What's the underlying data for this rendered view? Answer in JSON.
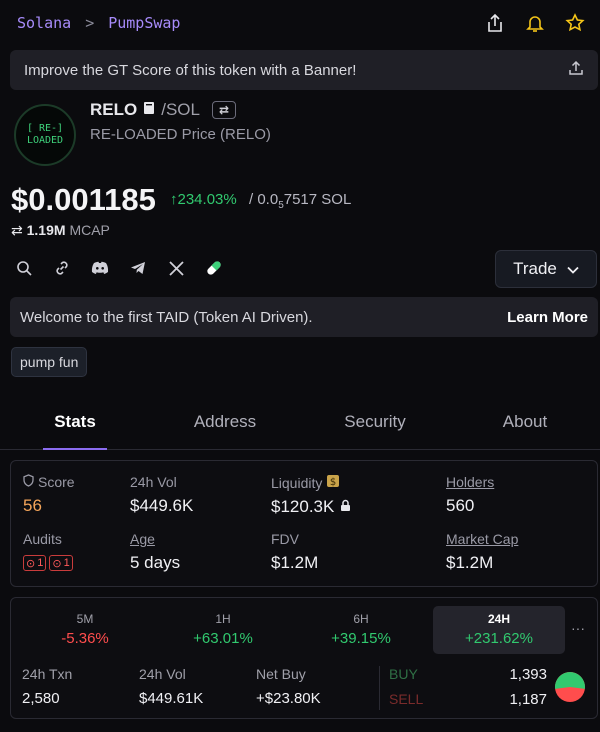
{
  "breadcrumb": {
    "chain": "Solana",
    "separator": ">",
    "dex": "PumpSwap"
  },
  "header_icons": [
    "share-icon",
    "bell-icon",
    "star-icon"
  ],
  "banner": {
    "text": "Improve the GT Score of this token with a Banner!"
  },
  "token": {
    "logo_line1": "[ RE-]",
    "logo_line2": "LOADED",
    "symbol": "RELO",
    "quote": "/SOL",
    "full_name": "RE-LOADED Price (RELO)",
    "price": "$0.001185",
    "change": "↑234.03%",
    "sol_price_prefix": "/ 0.0",
    "sol_price_sub": "5",
    "sol_price_suffix": "7517 SOL",
    "mcap_value": "1.19M",
    "mcap_label": "MCAP"
  },
  "actions": {
    "trade_label": "Trade"
  },
  "taid": {
    "text": "Welcome to the first TAID (Token AI Driven).",
    "link": "Learn More"
  },
  "tag": "pump fun",
  "tabs": [
    "Stats",
    "Address",
    "Security",
    "About"
  ],
  "stats": {
    "score_label": "Score",
    "score_value": "56",
    "vol_label": "24h Vol",
    "vol_value": "$449.6K",
    "liquidity_label": "Liquidity",
    "liquidity_value": "$120.3K",
    "holders_label": "Holders",
    "holders_value": "560",
    "audits_label": "Audits",
    "audit_badge_1": "1",
    "audit_badge_2": "1",
    "age_label": "Age",
    "age_value": "5 days",
    "fdv_label": "FDV",
    "fdv_value": "$1.2M",
    "mcap_label": "Market Cap",
    "mcap_value": "$1.2M"
  },
  "performance": {
    "periods": [
      {
        "label": "5M",
        "change": "-5.36%"
      },
      {
        "label": "1H",
        "change": "+63.01%"
      },
      {
        "label": "6H",
        "change": "+39.15%"
      },
      {
        "label": "24H",
        "change": "+231.62%"
      }
    ],
    "more": "···",
    "txn_label": "24h Txn",
    "txn_value": "2,580",
    "vol_label": "24h Vol",
    "vol_value": "$449.61K",
    "netbuy_label": "Net Buy",
    "netbuy_value": "+$23.80K",
    "buy_label": "BUY",
    "buy_value": "1,393",
    "sell_label": "SELL",
    "sell_value": "1,187",
    "buy_ratio": 0.54
  },
  "colors": {
    "accent": "#8b6cf0",
    "positive": "#31c96f",
    "negative": "#ff4d4d",
    "score": "#f5a55a"
  }
}
